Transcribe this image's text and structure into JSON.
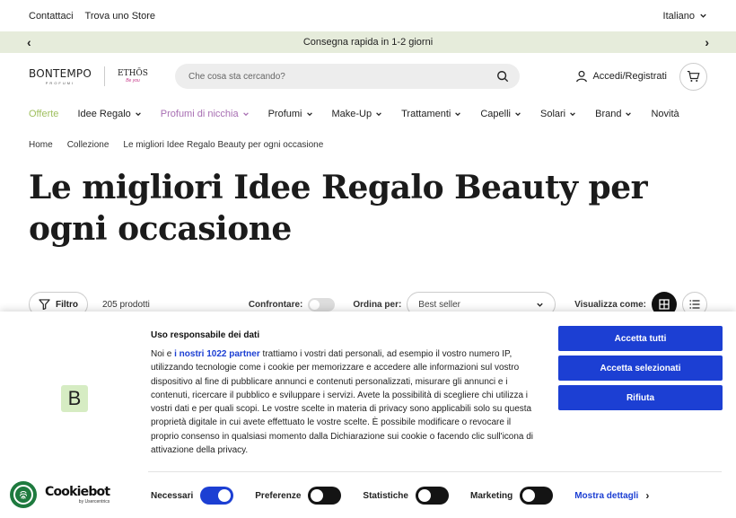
{
  "topbar": {
    "links": [
      "Contattaci",
      "Trova uno Store"
    ],
    "language": "Italiano"
  },
  "announcement": {
    "text": "Consegna rapida in 1-2 giorni"
  },
  "header": {
    "logo_main": "BONTEMPO",
    "logo_sub": "PROFUMI",
    "logo_second": "ETHŌS",
    "logo_second_sub": "Be you",
    "search_placeholder": "Che cosa sta cercando?",
    "login_label": "Accedi/Registrati"
  },
  "nav": [
    {
      "label": "Offerte",
      "color": "#9fbf5e",
      "chevron": false
    },
    {
      "label": "Idee Regalo",
      "color": "#222222",
      "chevron": true
    },
    {
      "label": "Profumi di nicchia",
      "color": "#a86fb3",
      "chevron": true
    },
    {
      "label": "Profumi",
      "color": "#222222",
      "chevron": true
    },
    {
      "label": "Make-Up",
      "color": "#222222",
      "chevron": true
    },
    {
      "label": "Trattamenti",
      "color": "#222222",
      "chevron": true
    },
    {
      "label": "Capelli",
      "color": "#222222",
      "chevron": true
    },
    {
      "label": "Solari",
      "color": "#222222",
      "chevron": true
    },
    {
      "label": "Brand",
      "color": "#222222",
      "chevron": true
    },
    {
      "label": "Novità",
      "color": "#222222",
      "chevron": false
    }
  ],
  "breadcrumb": [
    "Home",
    "Collezione",
    "Le migliori Idee Regalo Beauty per ogni occasione"
  ],
  "page_title": "Le migliori Idee Regalo Beauty per ogni occasione",
  "toolbar": {
    "filter_label": "Filtro",
    "count": "205 prodotti",
    "compare_label": "Confrontare:",
    "sort_label": "Ordina per:",
    "sort_value": "Best seller",
    "view_label": "Visualizza come:"
  },
  "cookie": {
    "logo_letter": "B",
    "title": "Uso responsabile dei dati",
    "body_before": "Noi e ",
    "partners_link": "i nostri 1022 partner",
    "body_after": " trattiamo i vostri dati personali, ad esempio il vostro numero IP, utilizzando tecnologie come i cookie per memorizzare e accedere alle informazioni sul vostro dispositivo al fine di pubblicare annunci e contenuti personalizzati, misurare gli annunci e i contenuti, ricercare il pubblico e sviluppare i servizi. Avete la possibilità di scegliere chi utilizza i vostri dati e per quali scopi. Le vostre scelte in materia di privacy sono applicabili solo su questa proprietà digitale in cui avete effettuato le vostre scelte. È possibile modificare o revocare il proprio consenso in qualsiasi momento dalla Dichiarazione sui cookie o facendo clic sull'icona di attivazione della privacy.",
    "buttons": {
      "accept_all": "Accetta tutti",
      "accept_selected": "Accetta selezionati",
      "reject": "Rifiuta"
    },
    "consents": [
      {
        "label": "Necessari",
        "on": true
      },
      {
        "label": "Preferenze",
        "on": false
      },
      {
        "label": "Statistiche",
        "on": false
      },
      {
        "label": "Marketing",
        "on": false
      }
    ],
    "details_label": "Mostra dettagli",
    "brand_name": "Cookiebot",
    "brand_by": "by Usercentrics"
  }
}
